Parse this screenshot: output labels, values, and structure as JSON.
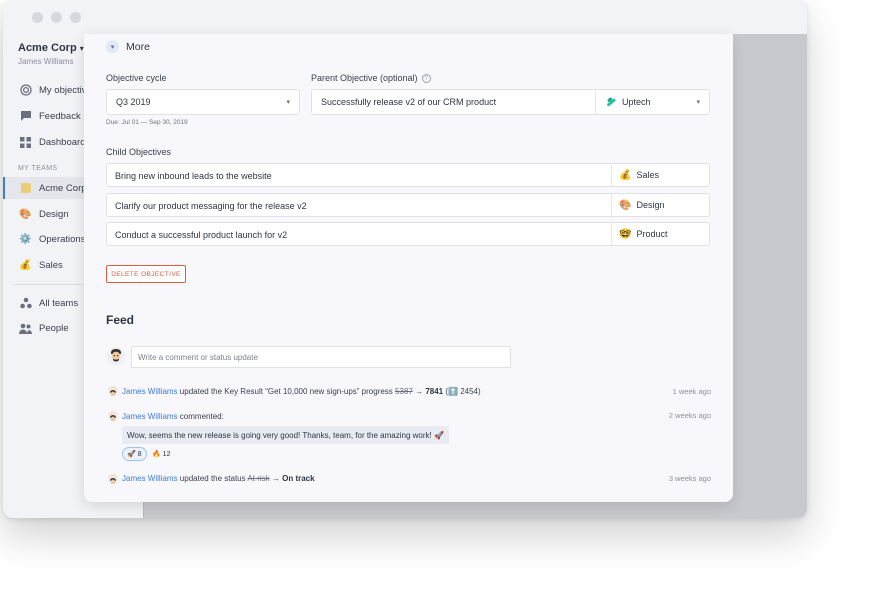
{
  "sidebar": {
    "org_name": "Acme Corp",
    "user_name": "James Williams",
    "items": [
      {
        "label": "My objectives",
        "icon": "target-icon"
      },
      {
        "label": "Feedback",
        "icon": "chat-icon"
      },
      {
        "label": "Dashboard",
        "icon": "grid-icon"
      }
    ],
    "section_label": "MY TEAMS",
    "teams": [
      {
        "label": "Acme Corp",
        "icon": "square-icon"
      },
      {
        "label": "Design",
        "icon": "palette-icon"
      },
      {
        "label": "Operations",
        "icon": "gear-icon"
      },
      {
        "label": "Sales",
        "icon": "moneybag-icon"
      }
    ],
    "bottom": [
      {
        "label": "All teams",
        "icon": "teams-icon"
      },
      {
        "label": "People",
        "icon": "people-icon"
      }
    ]
  },
  "modal": {
    "more_label": "More",
    "cycle_label": "Objective cycle",
    "cycle_value": "Q3 2019",
    "due_text": "Due: Jul 01 — Sep 30, 2019",
    "parent_label": "Parent Objective (optional)",
    "parent_value": "Successfully release v2 of our CRM product",
    "parent_team": "Uptech",
    "child_label": "Child Objectives",
    "children": [
      {
        "title": "Bring new inbound leads to the website",
        "team": "Sales",
        "emoji": "💰"
      },
      {
        "title": "Clarify our product messaging for the release v2",
        "team": "Design",
        "emoji": "🎨"
      },
      {
        "title": "Conduct a successful product launch for v2",
        "team": "Product",
        "emoji": "🤓"
      }
    ],
    "delete_label": "DELETE OBJECTIVE"
  },
  "feed": {
    "title": "Feed",
    "comment_placeholder": "Write a comment or status update",
    "entries": [
      {
        "user": "James Williams",
        "action": "updated the Key Result “Get 10,000 new sign-ups” progress",
        "old_value": "5387",
        "arrow": "→",
        "new_value": "7841",
        "delta": "(⬆️ 2454)",
        "time": "1 week ago"
      },
      {
        "user": "James Williams",
        "action": "commented:",
        "comment": "Wow, seems the new release is going very good! Thanks, team, for the amazing work! 🚀",
        "reactions": [
          {
            "emoji": "🚀",
            "count": "8"
          },
          {
            "emoji": "🔥",
            "count": "12"
          }
        ],
        "time": "2 weeks ago"
      },
      {
        "user": "James Williams",
        "action": "updated the status",
        "old_value": "At risk",
        "arrow": "→",
        "new_value": "On track",
        "time": "3 weeks ago"
      }
    ]
  }
}
